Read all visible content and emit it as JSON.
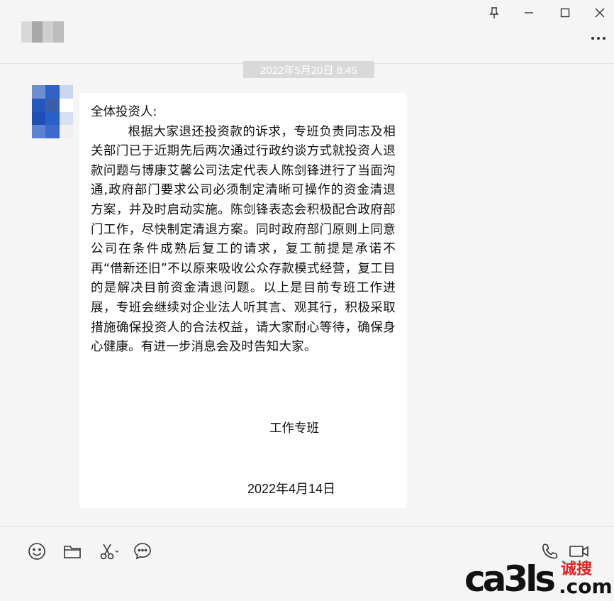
{
  "window": {
    "controls": {
      "pin_icon": "pin-icon",
      "minimize_icon": "minimize-icon",
      "maximize_icon": "maximize-icon",
      "close_icon": "close-icon"
    },
    "more_icon": "more-icon"
  },
  "chat": {
    "timestamp": "2022年5月20日 8:45",
    "message": {
      "salutation": "全体投资人:",
      "body": "根据大家退还投资款的诉求，专班负责同志及相关部门已于近期先后两次通过行政约谈方式就投资人退款问题与博康艾馨公司法定代表人陈剑锋进行了当面沟通,政府部门要求公司必须制定清晰可操作的资金清退方案，并及时启动实施。陈剑锋表态会积极配合政府部门工作，尽快制定清退方案。同时政府部门原则上同意公司在条件成熟后复工的请求，复工前提是承诺不再“借新还旧”不以原来吸收公众存款模式经营，复工目的是解决目前资金清退问题。以上是目前专班工作进展，专班会继续对企业法人听其言、观其行，积极采取措施确保投资人的合法权益，请大家耐心等待，确保身心健康。有进一步消息会及时告知大家。",
      "signature": "工作专班",
      "date": "2022年4月14日"
    }
  },
  "toolbar": {
    "icons": [
      "emoji-icon",
      "folder-icon",
      "scissors-icon",
      "chat-bubble-icon",
      "phone-icon",
      "video-icon"
    ]
  },
  "watermark": {
    "main": "ca3ls",
    "cn": "诚搜",
    "com": ".com"
  },
  "colors": {
    "background": "#f5f5f5",
    "bubble": "#ffffff",
    "timestamp_bg": "#d9d9d9",
    "watermark_red": "#e02020"
  }
}
